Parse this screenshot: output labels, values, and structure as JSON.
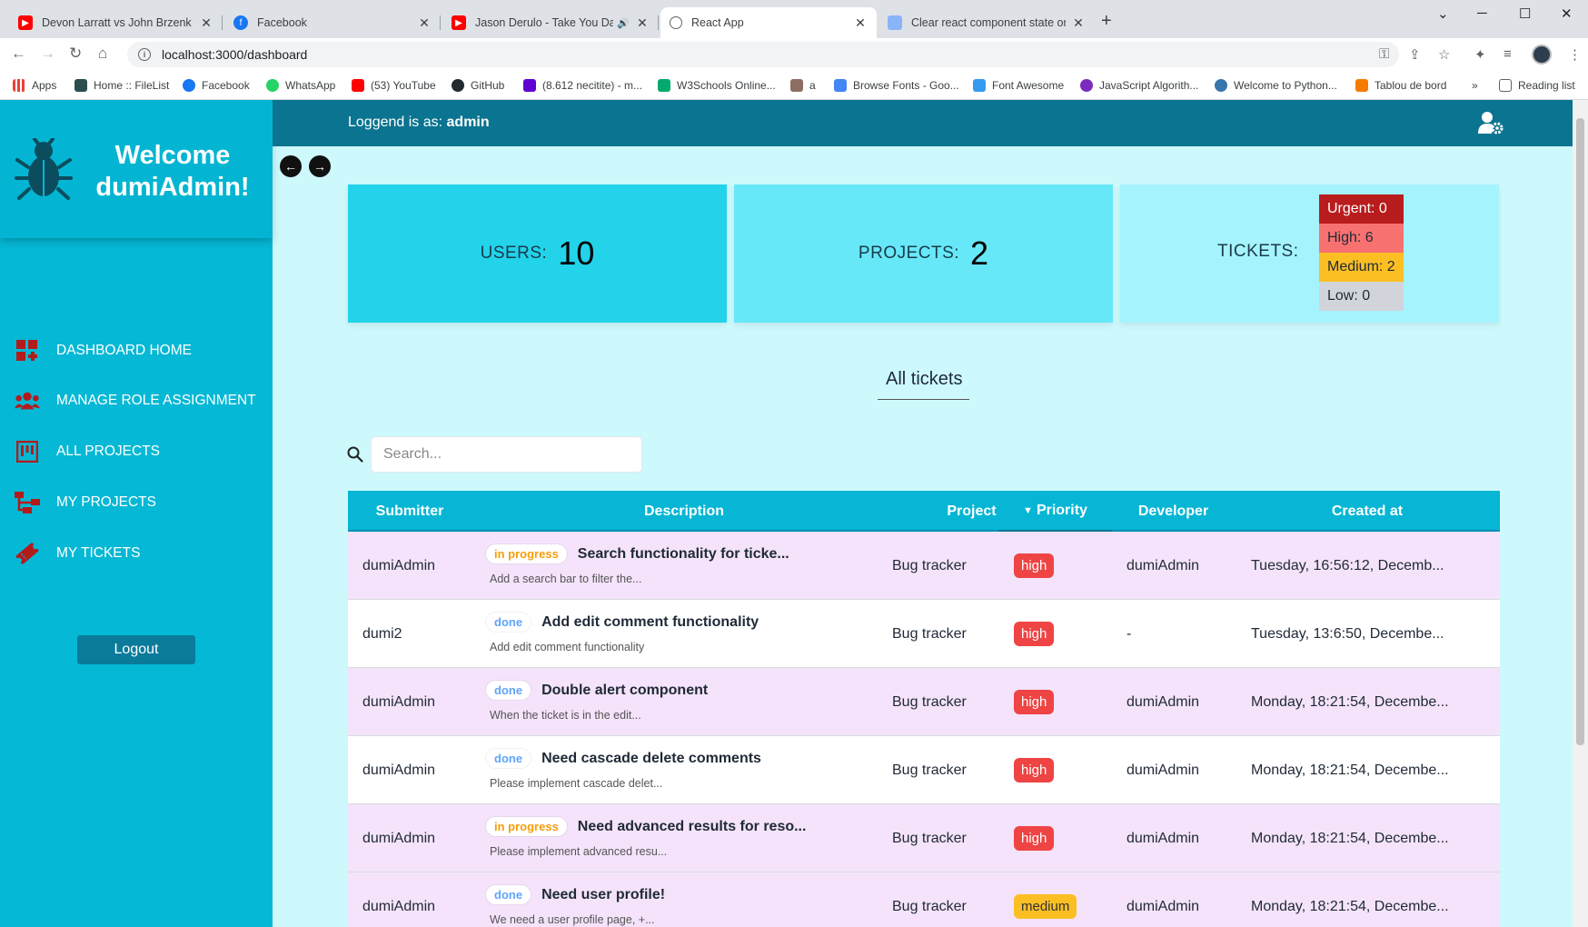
{
  "browser": {
    "tabs": [
      {
        "title": "Devon Larratt vs John Brzenk EXC",
        "icon": "youtube-icon"
      },
      {
        "title": "Facebook",
        "icon": "facebook-icon"
      },
      {
        "title": "Jason Derulo - Take You Dan",
        "icon": "youtube-icon"
      },
      {
        "title": "React App",
        "icon": "globe-icon",
        "active": true
      },
      {
        "title": "Clear react component state on",
        "icon": "page-icon"
      }
    ],
    "url": "localhost:3000/dashboard",
    "bookmarks": [
      {
        "label": "Apps",
        "color": "#ea4335"
      },
      {
        "label": "Home :: FileList",
        "color": "#2b4d4d"
      },
      {
        "label": "Facebook",
        "color": "#1877f2"
      },
      {
        "label": "WhatsApp",
        "color": "#25d366"
      },
      {
        "label": "(53) YouTube",
        "color": "#ff0000"
      },
      {
        "label": "GitHub",
        "color": "#24292e"
      },
      {
        "label": "(8.612 necitite) - m...",
        "color": "#6001d2"
      },
      {
        "label": "W3Schools Online...",
        "color": "#04aa6d"
      },
      {
        "label": "a",
        "color": "#8d6e63"
      },
      {
        "label": "Browse Fonts - Goo...",
        "color": "#4285f4"
      },
      {
        "label": "Font Awesome",
        "color": "#339af0"
      },
      {
        "label": "JavaScript Algorith...",
        "color": "#7b2cbf"
      },
      {
        "label": "Welcome to Python...",
        "color": "#3776ab"
      },
      {
        "label": "Tablou de bord",
        "color": "#f57c00"
      }
    ],
    "reading_list": "Reading list"
  },
  "sidebar": {
    "welcome": "Welcome dumiAdmin!",
    "items": [
      {
        "label": "DASHBOARD HOME",
        "icon": "dashboard-add-icon"
      },
      {
        "label": "MANAGE ROLE ASSIGNMENT",
        "icon": "users-icon"
      },
      {
        "label": "ALL PROJECTS",
        "icon": "project-board-icon"
      },
      {
        "label": "MY PROJECTS",
        "icon": "sitemap-icon"
      },
      {
        "label": "MY TICKETS",
        "icon": "ticket-icon"
      }
    ],
    "logout": "Logout"
  },
  "topbar": {
    "logged_prefix": "Loggend is as:",
    "role": "admin"
  },
  "stats": {
    "users_label": "USERS:",
    "users_value": "10",
    "projects_label": "PROJECTS:",
    "projects_value": "2",
    "tickets_label": "TICKETS:",
    "levels": [
      {
        "label": "Urgent: 0",
        "bg": "#b91c1c",
        "fg": "#ffffff"
      },
      {
        "label": "High: 6",
        "bg": "#f87171",
        "fg": "#1f2937"
      },
      {
        "label": "Medium: 2",
        "bg": "#fbbf24",
        "fg": "#1f2937"
      },
      {
        "label": "Low: 0",
        "bg": "#d1d5db",
        "fg": "#1f2937"
      }
    ]
  },
  "tickets_section": {
    "title": "All tickets",
    "search_placeholder": "Search..."
  },
  "table": {
    "columns": [
      "Submitter",
      "Description",
      "Project",
      "Priority",
      "Developer",
      "Created at"
    ],
    "rows": [
      {
        "submitter": "dumiAdmin",
        "status": "in progress",
        "status_class": "inprogress",
        "title": "Search functionality for ticke...",
        "subtitle": "Add a search bar to filter the...",
        "project": "Bug tracker",
        "priority": "high",
        "developer": "dumiAdmin",
        "created": "Tuesday, 16:56:12, Decemb..."
      },
      {
        "submitter": "dumi2",
        "status": "done",
        "status_class": "done",
        "title": "Add edit comment functionality",
        "subtitle": "Add edit comment functionality",
        "project": "Bug tracker",
        "priority": "high",
        "developer": "-",
        "created": "Tuesday, 13:6:50, Decembe..."
      },
      {
        "submitter": "dumiAdmin",
        "status": "done",
        "status_class": "done",
        "title": "Double alert component",
        "subtitle": "When the ticket is in the edit...",
        "project": "Bug tracker",
        "priority": "high",
        "developer": "dumiAdmin",
        "created": "Monday, 18:21:54, Decembe..."
      },
      {
        "submitter": "dumiAdmin",
        "status": "done",
        "status_class": "done",
        "title": "Need cascade delete comments",
        "subtitle": "Please implement cascade delet...",
        "project": "Bug tracker",
        "priority": "high",
        "developer": "dumiAdmin",
        "created": "Monday, 18:21:54, Decembe..."
      },
      {
        "submitter": "dumiAdmin",
        "status": "in progress",
        "status_class": "inprogress",
        "title": "Need advanced results for reso...",
        "subtitle": "Please implement advanced resu...",
        "project": "Bug tracker",
        "priority": "high",
        "developer": "dumiAdmin",
        "created": "Monday, 18:21:54, Decembe..."
      },
      {
        "submitter": "dumiAdmin",
        "status": "done",
        "status_class": "done",
        "title": "Need user profile!",
        "subtitle": "We need a user profile page, +...",
        "project": "Bug tracker",
        "priority": "medium",
        "developer": "dumiAdmin",
        "created": "Monday, 18:21:54, Decembe..."
      }
    ]
  }
}
